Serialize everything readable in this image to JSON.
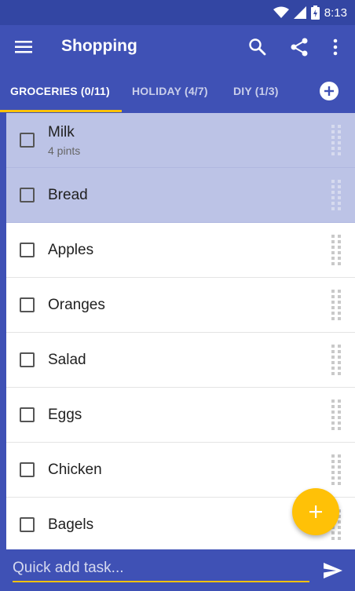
{
  "status_bar": {
    "time": "8:13",
    "icons": [
      "wifi-icon",
      "signal-icon",
      "battery-icon"
    ]
  },
  "app_bar": {
    "title": "Shopping",
    "icons": [
      "menu-icon",
      "search-icon",
      "share-icon",
      "more-vert-icon"
    ]
  },
  "tabs": [
    {
      "label": "GROCERIES (0/11)",
      "active": true
    },
    {
      "label": "HOLIDAY (4/7)",
      "active": false
    },
    {
      "label": "DIY (1/3)",
      "active": false
    }
  ],
  "items": [
    {
      "title": "Milk",
      "subtitle": "4 pints",
      "checked": false,
      "selected": true
    },
    {
      "title": "Bread",
      "subtitle": "",
      "checked": false,
      "selected": true
    },
    {
      "title": "Apples",
      "subtitle": "",
      "checked": false,
      "selected": false
    },
    {
      "title": "Oranges",
      "subtitle": "",
      "checked": false,
      "selected": false
    },
    {
      "title": "Salad",
      "subtitle": "",
      "checked": false,
      "selected": false
    },
    {
      "title": "Eggs",
      "subtitle": "",
      "checked": false,
      "selected": false
    },
    {
      "title": "Chicken",
      "subtitle": "",
      "checked": false,
      "selected": false
    },
    {
      "title": "Bagels",
      "subtitle": "",
      "checked": false,
      "selected": false
    }
  ],
  "quick_add": {
    "placeholder": "Quick add task..."
  },
  "colors": {
    "primary": "#3f51b5",
    "primary_dark": "#3346a3",
    "accent": "#ffc107",
    "selected_row": "#bcc3e6"
  }
}
